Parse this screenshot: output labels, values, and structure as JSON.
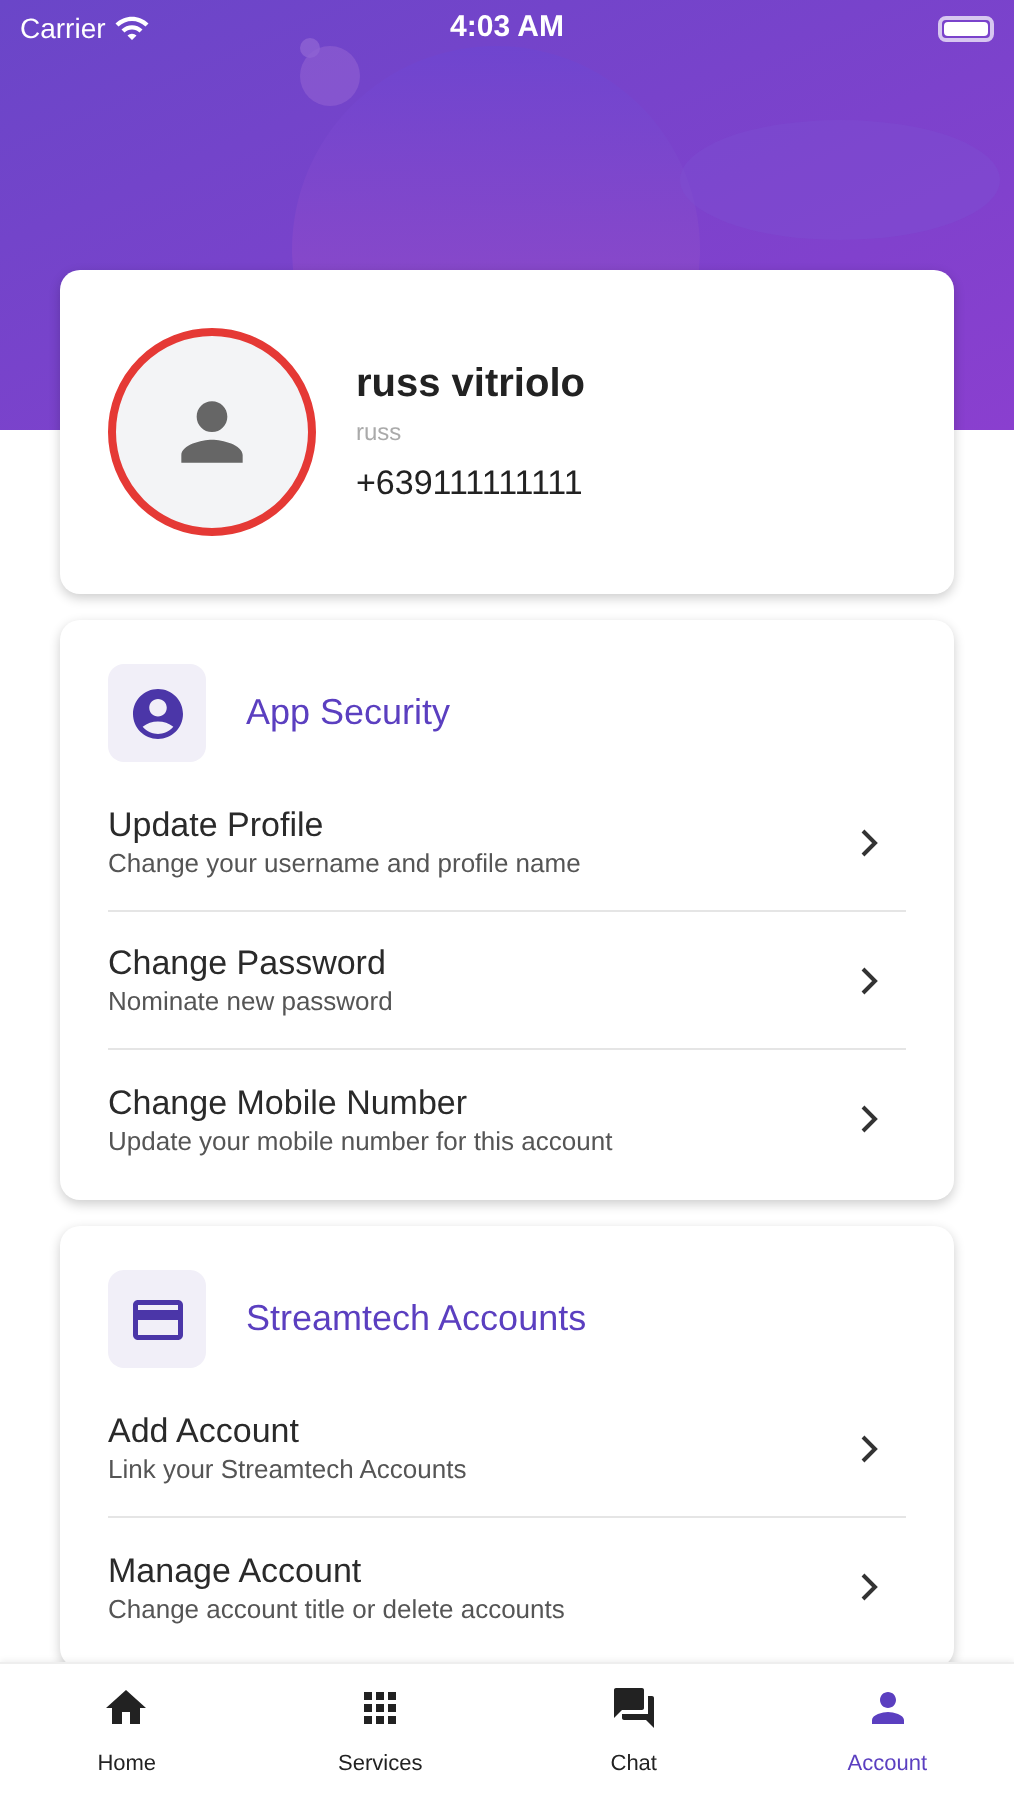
{
  "status_bar": {
    "carrier": "Carrier",
    "time": "4:03 AM"
  },
  "profile": {
    "name": "russ vitriolo",
    "username": "russ",
    "phone": "+639111111111"
  },
  "sections": [
    {
      "title": "App Security",
      "kind": "security",
      "items": [
        {
          "title": "Update Profile",
          "subtitle": "Change your username and profile name"
        },
        {
          "title": "Change Password",
          "subtitle": "Nominate new password"
        },
        {
          "title": "Change Mobile Number",
          "subtitle": "Update your mobile number for this account"
        }
      ]
    },
    {
      "title": "Streamtech Accounts",
      "kind": "card",
      "items": [
        {
          "title": "Add Account",
          "subtitle": "Link your Streamtech Accounts"
        },
        {
          "title": "Manage Account",
          "subtitle": "Change account title or delete accounts"
        }
      ]
    }
  ],
  "tabs": [
    {
      "label": "Home",
      "kind": "home",
      "selected": false
    },
    {
      "label": "Services",
      "kind": "services",
      "selected": false
    },
    {
      "label": "Chat",
      "kind": "chat",
      "selected": false
    },
    {
      "label": "Account",
      "kind": "account",
      "selected": true
    }
  ]
}
